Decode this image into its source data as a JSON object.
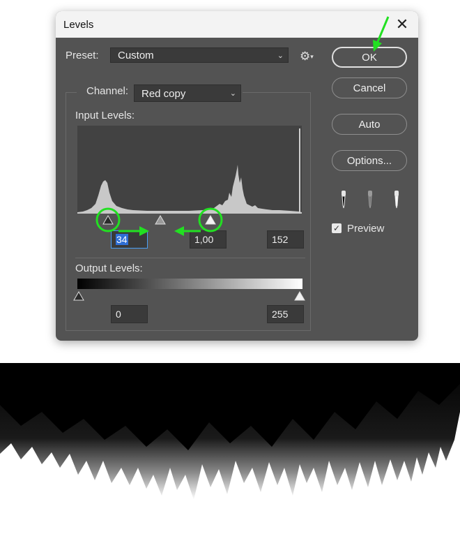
{
  "window": {
    "title": "Levels",
    "close_glyph": "✕"
  },
  "preset": {
    "label": "Preset:",
    "value": "Custom"
  },
  "channel": {
    "label": "Channel:",
    "value": "Red copy"
  },
  "input_levels": {
    "label": "Input Levels:",
    "black": "34",
    "midtone": "1,00",
    "white": "152"
  },
  "output_levels": {
    "label": "Output Levels:",
    "black": "0",
    "white": "255"
  },
  "buttons": {
    "ok": "OK",
    "cancel": "Cancel",
    "auto": "Auto",
    "options": "Options..."
  },
  "preview": {
    "label": "Preview",
    "checked": true,
    "check_glyph": "✓"
  },
  "icons": {
    "settings": "gear-icon",
    "close": "close-icon",
    "eyedroppers": [
      "black-point-eyedropper-icon",
      "gray-point-eyedropper-icon",
      "white-point-eyedropper-icon"
    ]
  },
  "annotation_color": "#22e022"
}
